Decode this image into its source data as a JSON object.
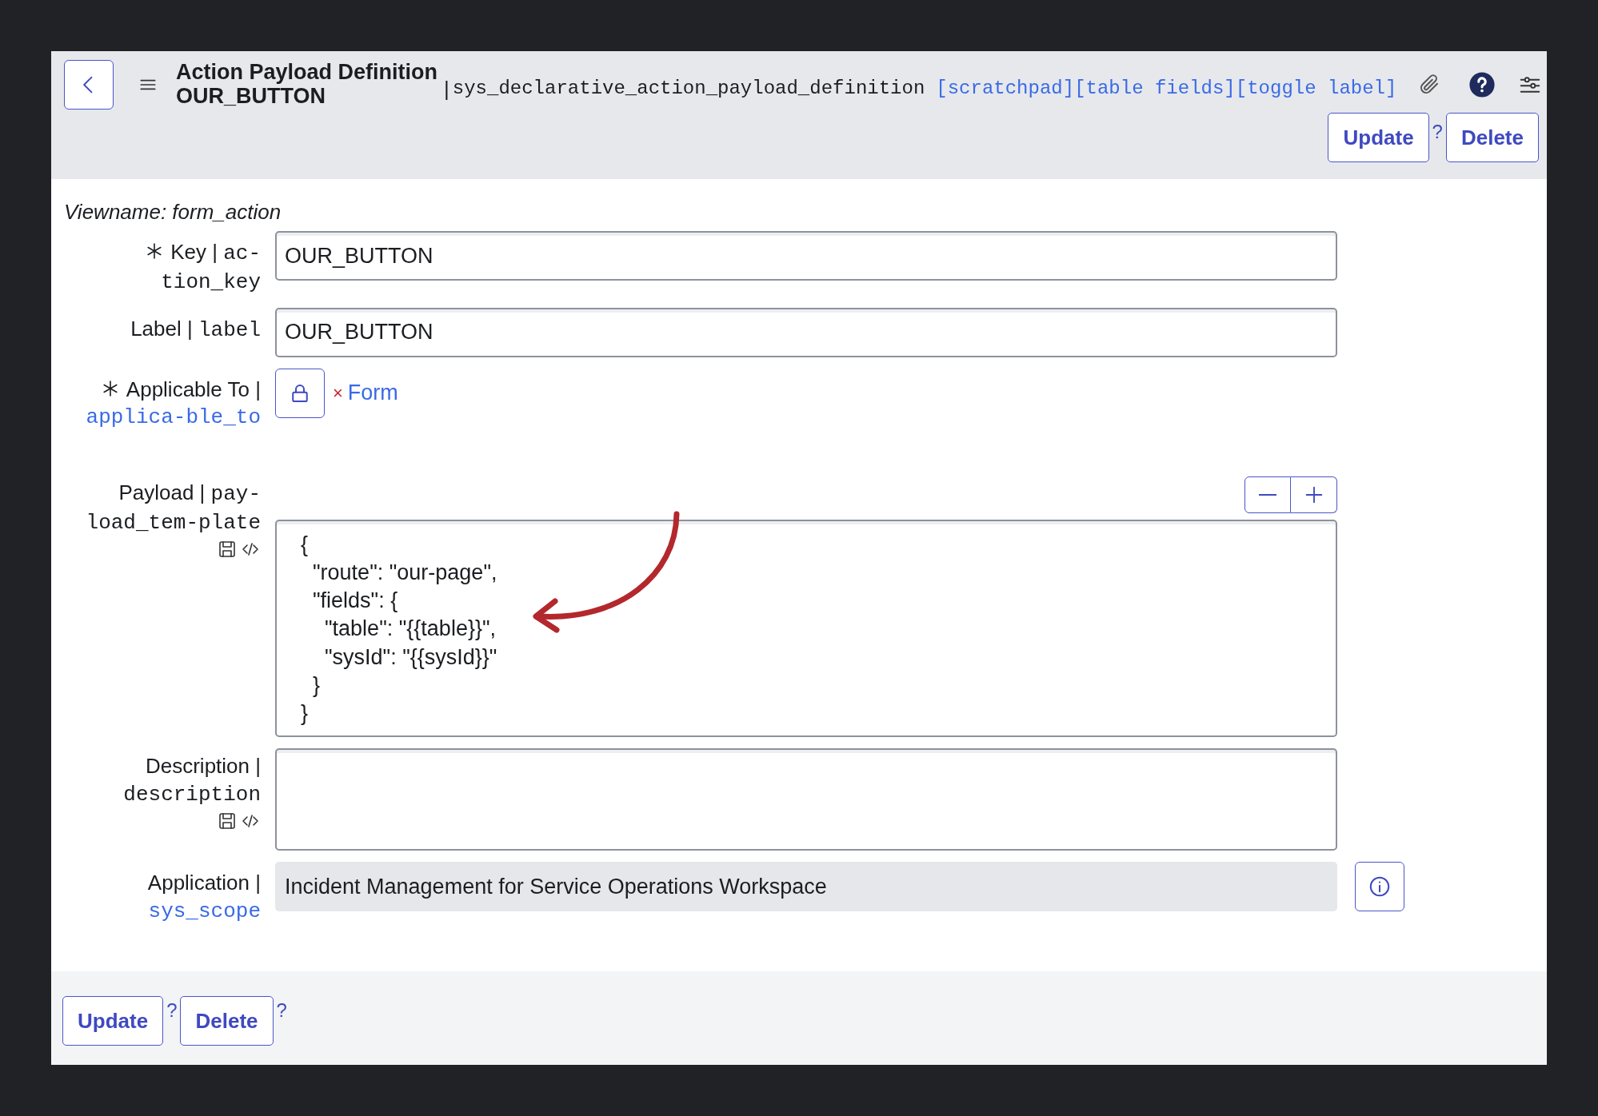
{
  "header": {
    "title": "Action Payload Definition",
    "subtitle": "OUR_BUTTON",
    "separator": "|",
    "table_name": "sys_declarative_action_payload_definition",
    "links": [
      "[scratchpad]",
      "[table fields]",
      "[toggle label]"
    ],
    "buttons": [
      {
        "label": "Update",
        "help": "?"
      },
      {
        "label": "Delete"
      }
    ]
  },
  "viewname": "Viewname: form_action",
  "fields": [
    {
      "kind": "text",
      "mandatory": true,
      "label": "Key |",
      "field_name": "ac-tion_key",
      "field_link": false,
      "value": "OUR_BUTTON"
    },
    {
      "kind": "text",
      "mandatory": false,
      "label": "Label |",
      "field_name": "label",
      "field_link": false,
      "value": "OUR_BUTTON"
    },
    {
      "kind": "reference",
      "mandatory": true,
      "label": "Applicable To |",
      "field_name": "applica-ble_to",
      "field_link": true,
      "remove": "×",
      "value": "Form"
    },
    {
      "kind": "script",
      "mandatory": false,
      "label": "Payload |",
      "field_name": "pay-load_tem-plate",
      "field_link": false,
      "editor_icons": true,
      "value": "{\n  \"route\": \"our-page\",\n  \"fields\": {\n    \"table\": \"{{table}}\",\n    \"sysId\": \"{{sysId}}\"\n  }\n}"
    },
    {
      "kind": "textarea",
      "mandatory": false,
      "label": "Description |",
      "field_name": "description",
      "field_link": false,
      "editor_icons": true
    },
    {
      "kind": "readonly",
      "mandatory": false,
      "label": "Application |",
      "field_name": "sys_scope",
      "field_link": true,
      "value": "Incident Management for Service Operations Workspace"
    }
  ],
  "footer_buttons": [
    {
      "label": "Update",
      "help": "?"
    },
    {
      "label": "Delete",
      "help": "?"
    }
  ]
}
